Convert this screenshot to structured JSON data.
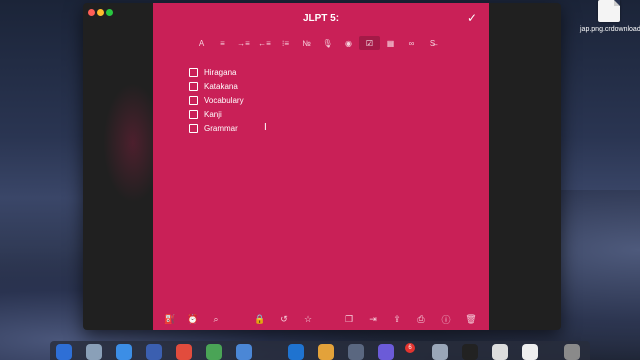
{
  "desktop": {
    "file_label": "jap.png.crdownload"
  },
  "note": {
    "title": "JLPT 5:",
    "checklist": [
      "Hiragana",
      "Katakana",
      "Vocabulary",
      "Kanji",
      "Grammar"
    ]
  },
  "colors": {
    "note_bg": "#c92057",
    "window_bg": "#202020"
  },
  "dock": {
    "badge_count": "6"
  }
}
